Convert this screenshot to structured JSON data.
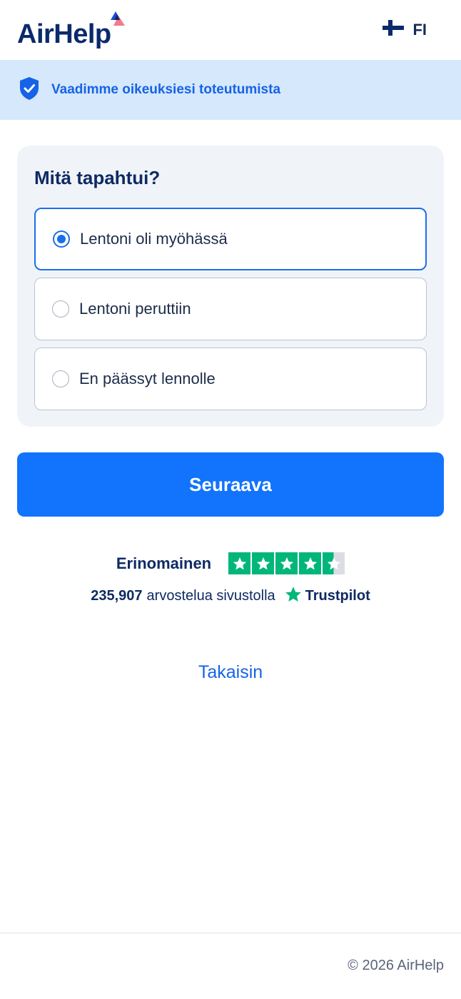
{
  "header": {
    "logo_text": "AirHelp",
    "language_code": "FI"
  },
  "banner": {
    "text": "Vaadimme oikeuksiesi toteutumista"
  },
  "form": {
    "question": "Mitä tapahtui?",
    "options": [
      {
        "label": "Lentoni oli myöhässä",
        "selected": true
      },
      {
        "label": "Lentoni peruttiin",
        "selected": false
      },
      {
        "label": "En päässyt lennolle",
        "selected": false
      }
    ],
    "next_button": "Seuraava"
  },
  "trustpilot": {
    "rating_word": "Erinomainen",
    "stars": 4.5,
    "review_count": "235,907",
    "review_text": "arvostelua sivustolla",
    "brand": "Trustpilot"
  },
  "back_link": "Takaisin",
  "footer": {
    "copyright": "© 2026 AirHelp"
  },
  "colors": {
    "primary": "#1273fd",
    "navy": "#0f2a63",
    "banner_bg": "#d6e8fb",
    "trustpilot_green": "#00b67a"
  }
}
